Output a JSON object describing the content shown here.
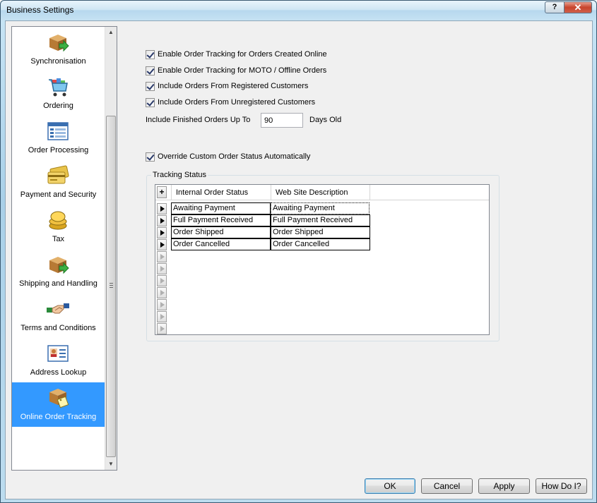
{
  "window": {
    "title": "Business Settings",
    "help_label": "?",
    "close_label": "✕"
  },
  "sidebar": {
    "items": [
      {
        "label": "Synchronisation",
        "icon": "box-sync-icon"
      },
      {
        "label": "Ordering",
        "icon": "shopping-cart-icon"
      },
      {
        "label": "Order Processing",
        "icon": "order-form-icon"
      },
      {
        "label": "Payment and Security",
        "icon": "credit-card-icon"
      },
      {
        "label": "Tax",
        "icon": "coins-icon"
      },
      {
        "label": "Shipping and Handling",
        "icon": "box-arrow-icon"
      },
      {
        "label": "Terms and Conditions",
        "icon": "handshake-icon"
      },
      {
        "label": "Address Lookup",
        "icon": "address-card-icon"
      },
      {
        "label": "Online Order Tracking",
        "icon": "box-tag-icon",
        "selected": true
      }
    ]
  },
  "options": {
    "enable_online": "Enable Order Tracking for Orders Created Online",
    "enable_moto": "Enable Order Tracking for MOTO / Offline Orders",
    "include_registered": "Include Orders From Registered Customers",
    "include_unregistered": "Include Orders From Unregistered Customers",
    "finished_prefix": "Include Finished Orders Up To",
    "finished_value": "90",
    "finished_suffix": "Days Old",
    "override_status": "Override Custom Order Status Automatically"
  },
  "tracking": {
    "group_title": "Tracking Status",
    "add_label": "+",
    "columns": [
      "Internal Order Status",
      "Web Site Description"
    ],
    "rows": [
      [
        "Awaiting Payment",
        "Awaiting Payment"
      ],
      [
        "Full Payment Received",
        "Full Payment Received"
      ],
      [
        "Order Shipped",
        "Order Shipped"
      ],
      [
        "Order Cancelled",
        "Order Cancelled"
      ]
    ]
  },
  "buttons": {
    "ok": "OK",
    "cancel": "Cancel",
    "apply": "Apply",
    "howdoi": "How Do I?"
  },
  "colors": {
    "selection": "#3399ff",
    "dialog_bg": "#f0f0f0"
  }
}
